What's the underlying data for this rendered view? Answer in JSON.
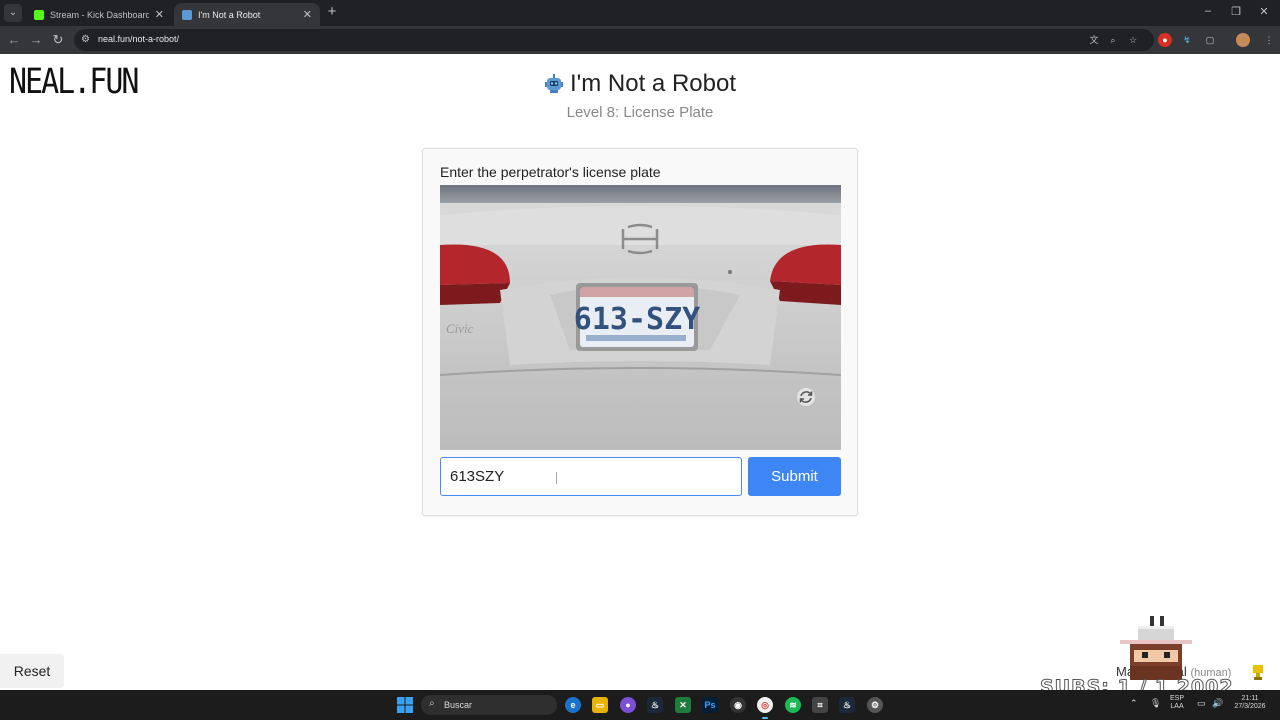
{
  "browser": {
    "tabs": [
      {
        "title": "Stream - Kick Dashboard",
        "favicon": "kick-icon",
        "color": "#53fc18"
      },
      {
        "title": "I'm Not a Robot",
        "favicon": "robot-icon",
        "color": "#5b9bd5",
        "active": true
      }
    ],
    "url": "neal.fun/not-a-robot/"
  },
  "page": {
    "logo": "NEAL.FUN",
    "title": "I'm Not a Robot",
    "subtitle": "Level 8: License Plate",
    "card": {
      "instruction": "Enter the perpetrator's license plate",
      "image_plate_text": "613-SZY",
      "input_value": "613SZY",
      "submit_label": "Submit"
    },
    "reset_label": "Reset",
    "player": {
      "name_prefix": "Ma",
      "name_suffix": "Neal",
      "role": "(human)"
    },
    "stream_overlay": "SUBS: 1 / 1 2002"
  },
  "taskbar": {
    "search_label": "Buscar",
    "language": "ESP",
    "layout": "LAA",
    "time": "21:11",
    "date": "27/3/2026"
  },
  "colors": {
    "accent": "#3f86f5",
    "chrome_dark": "#202124",
    "chrome_toolbar": "#35363a"
  }
}
